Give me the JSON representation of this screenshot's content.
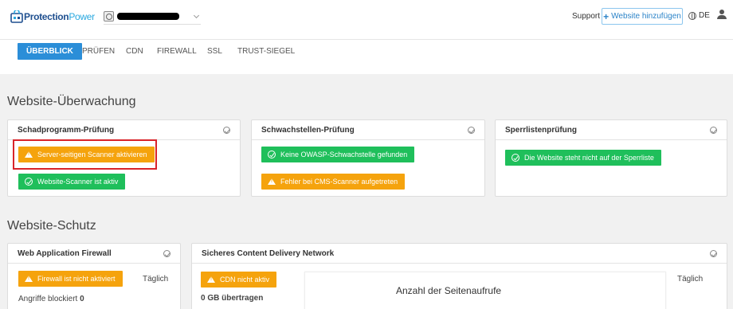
{
  "header": {
    "logo_bold": "Protection",
    "logo_light": "Power",
    "support": "Support",
    "add_site": "Website hinzufügen",
    "language": "DE"
  },
  "tabs": [
    {
      "label": "ÜBERBLICK"
    },
    {
      "label": "PRÜFEN"
    },
    {
      "label": "CDN"
    },
    {
      "label": "FIREWALL"
    },
    {
      "label": "SSL"
    },
    {
      "label": "TRUST-SIEGEL"
    }
  ],
  "monitoring": {
    "title": "Website-Überwachung",
    "malware": {
      "title": "Schadprogramm-Prüfung",
      "server_scan": "Server-seitigen Scanner aktivieren",
      "site_scan": "Website-Scanner ist aktiv"
    },
    "vulnerability": {
      "title": "Schwachstellen-Prüfung",
      "owasp": "Keine OWASP-Schwachstelle gefunden",
      "cms_error": "Fehler bei CMS-Scanner aufgetreten"
    },
    "blacklist": {
      "title": "Sperrlistenprüfung",
      "status": "Die Website steht nicht auf der Sperrliste"
    }
  },
  "protection": {
    "title": "Website-Schutz",
    "waf": {
      "title": "Web Application Firewall",
      "status": "Firewall ist nicht aktiviert",
      "period": "Täglich",
      "blocked_label": "Angriffe blockiert",
      "blocked_value": "0"
    },
    "cdn": {
      "title": "Sicheres Content Delivery Network",
      "status": "CDN nicht aktiv",
      "transferred": "0 GB übertragen",
      "chart_title": "Anzahl der Seitenaufrufe",
      "period": "Täglich"
    }
  },
  "colors": {
    "accent": "#2b8ed8",
    "warning": "#f5a30d",
    "success": "#1fbf5b",
    "highlight": "#d9242a"
  }
}
